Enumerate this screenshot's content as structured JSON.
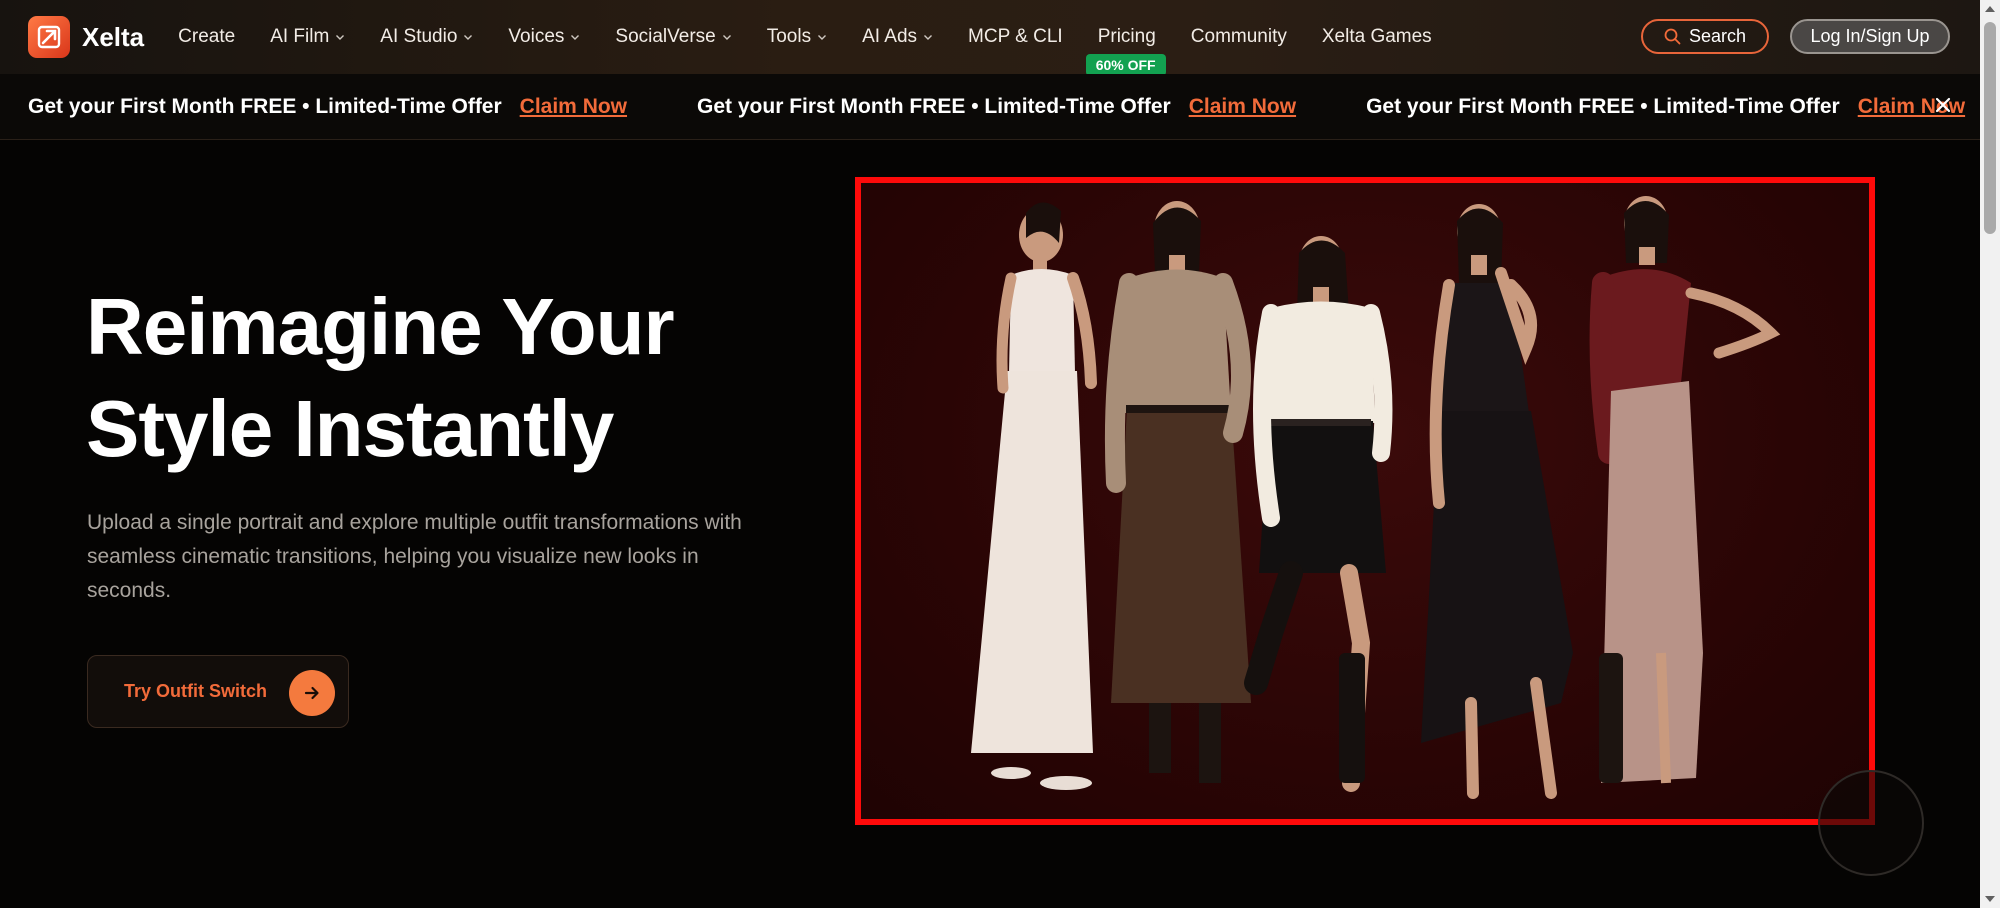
{
  "brand": {
    "name": "Xelta",
    "accent": "#f26b3a"
  },
  "nav": {
    "items": [
      {
        "label": "Create",
        "dropdown": false
      },
      {
        "label": "AI Film",
        "dropdown": true
      },
      {
        "label": "AI Studio",
        "dropdown": true
      },
      {
        "label": "Voices",
        "dropdown": true
      },
      {
        "label": "SocialVerse",
        "dropdown": true
      },
      {
        "label": "Tools",
        "dropdown": true
      },
      {
        "label": "AI Ads",
        "dropdown": true
      },
      {
        "label": "MCP & CLI",
        "dropdown": false
      },
      {
        "label": "Pricing",
        "dropdown": false,
        "badge": "60% OFF"
      },
      {
        "label": "Community",
        "dropdown": false
      },
      {
        "label": "Xelta Games",
        "dropdown": false
      }
    ],
    "search_label": "Search",
    "login_label": "Log In/Sign Up"
  },
  "promo": {
    "text": "Get your First Month FREE • Limited-Time Offer",
    "cta": "Claim Now",
    "repeat_count_visible": 3
  },
  "hero": {
    "title_line1": "Reimagine Your",
    "title_line2": "Style Instantly",
    "subtitle": "Upload a single portrait and explore multiple outfit transformations with seamless cinematic transitions, helping you visualize new looks in seconds.",
    "cta_label": "Try Outfit Switch"
  },
  "colors": {
    "highlight_border": "#ff0a0a",
    "badge_green": "#12a150",
    "cta_orange": "#f47a3e"
  }
}
